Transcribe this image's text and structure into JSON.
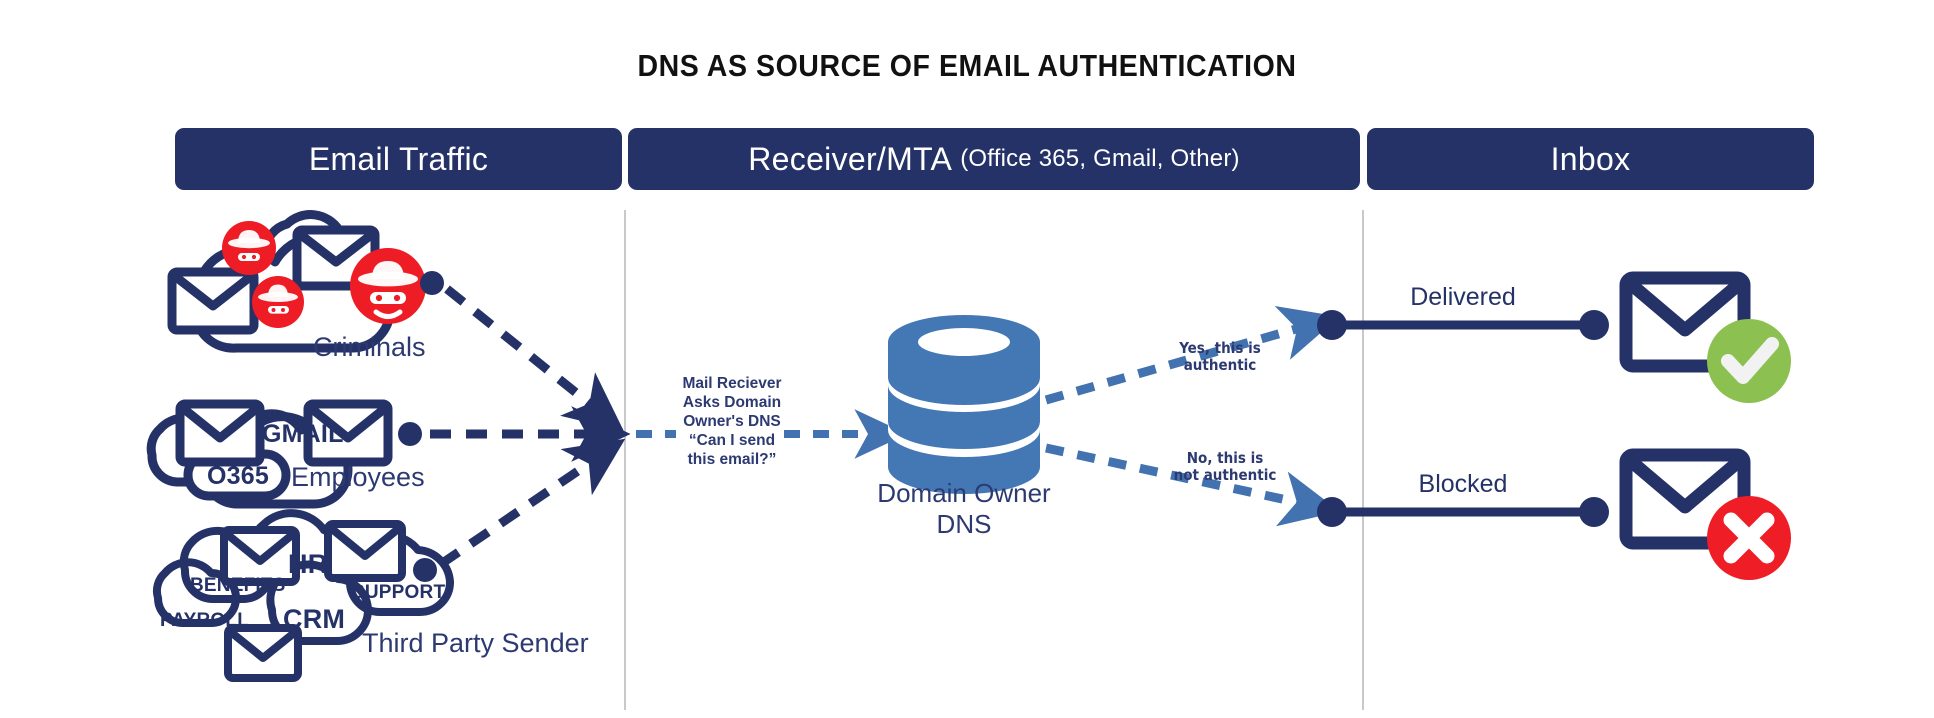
{
  "title": "DNS AS SOURCE OF EMAIL AUTHENTICATION",
  "colors": {
    "navy": "#253268",
    "navy_text": "#2d3a72",
    "mid_blue": "#4372b0",
    "db_blue": "#4478b5",
    "red": "#ee1c25",
    "red_x": "#ef1d25",
    "green": "#8cc152",
    "divider": "#c9c9c9",
    "white": "#ffffff"
  },
  "headers": [
    {
      "id": "email-traffic",
      "label": "Email Traffic",
      "sublabel": ""
    },
    {
      "id": "receiver-mta",
      "label": "Receiver/MTA",
      "sublabel": "(Office 365, Gmail, Other)"
    },
    {
      "id": "inbox",
      "label": "Inbox",
      "sublabel": ""
    }
  ],
  "senders": [
    {
      "id": "criminals",
      "label": "Criminals",
      "icon": "hacker-icon",
      "cloud_words": []
    },
    {
      "id": "employees",
      "label": "Employees",
      "icon": "envelope-icon",
      "cloud_words": [
        "GMAIL",
        "O365"
      ]
    },
    {
      "id": "third-party-sender",
      "label": "Third Party Sender",
      "icon": "envelope-icon",
      "cloud_words": [
        "BENEFITS",
        "HR",
        "SUPPORT",
        "PAYROLL",
        "CRM"
      ]
    }
  ],
  "center": {
    "query_text_lines": [
      "Mail Reciever",
      "Asks Domain",
      "Owner's DNS",
      "“Can I send",
      "this email?”"
    ],
    "dns_label_lines": [
      "Domain Owner",
      "DNS"
    ],
    "dns_icon": "database-icon"
  },
  "branches": [
    {
      "id": "authentic",
      "condition_lines": [
        "Yes, this is",
        "authentic"
      ],
      "route_label": "Delivered",
      "result_icon": "check-circle-icon",
      "result_color": "#8cc152"
    },
    {
      "id": "not-authentic",
      "condition_lines": [
        "No, this is",
        "not authentic"
      ],
      "route_label": "Blocked",
      "result_icon": "x-circle-icon",
      "result_color": "#ef1d25"
    }
  ]
}
